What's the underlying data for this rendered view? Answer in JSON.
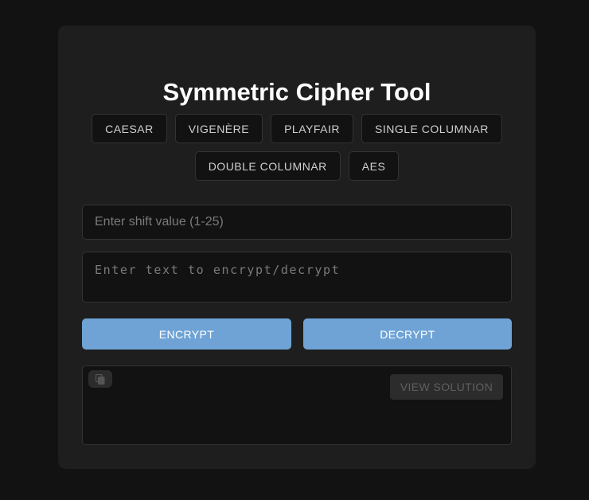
{
  "title": "Symmetric Cipher Tool",
  "tabs": [
    {
      "label": "CAESAR"
    },
    {
      "label": "VIGENÈRE"
    },
    {
      "label": "PLAYFAIR"
    },
    {
      "label": "SINGLE COLUMNAR"
    },
    {
      "label": "DOUBLE COLUMNAR"
    },
    {
      "label": "AES"
    }
  ],
  "shift": {
    "placeholder": "Enter shift value (1-25)",
    "value": ""
  },
  "text": {
    "placeholder": "Enter text to encrypt/decrypt",
    "value": ""
  },
  "actions": {
    "encrypt_label": "ENCRYPT",
    "decrypt_label": "DECRYPT"
  },
  "output": {
    "copy_icon": "copy-icon",
    "view_solution_label": "VIEW SOLUTION"
  },
  "colors": {
    "page_background": "#121212",
    "card_background": "#1e1e1e",
    "accent": "#6fa3d6",
    "field_border": "#333333"
  }
}
